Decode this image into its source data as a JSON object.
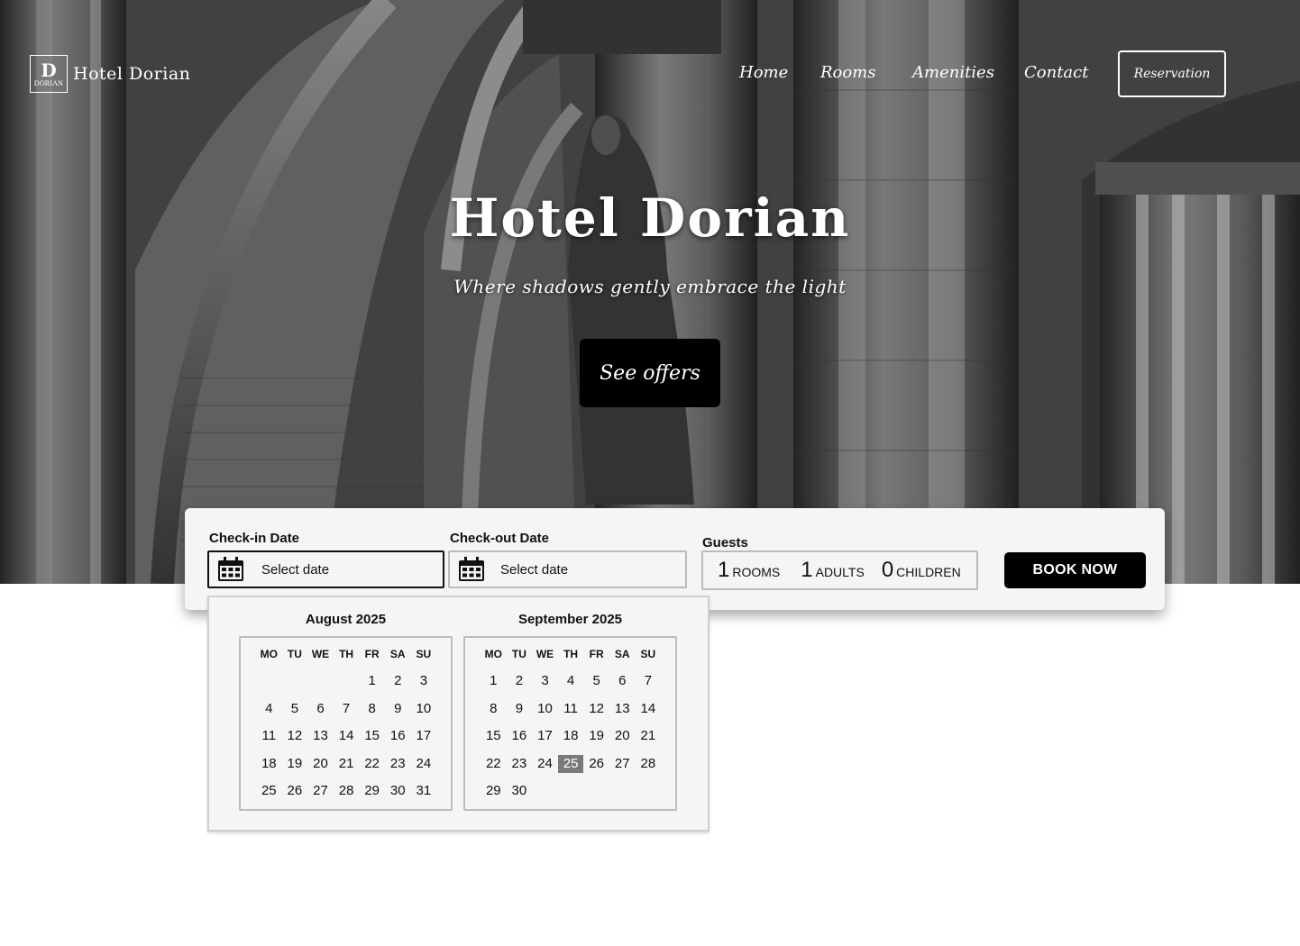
{
  "brand": {
    "logo_letter": "D",
    "logo_sub": "DORIAN",
    "name": "Hotel Dorian"
  },
  "nav": {
    "items": [
      "Home",
      "Rooms",
      "Amenities",
      "Contact"
    ],
    "reservation_label": "Reservation"
  },
  "hero": {
    "title": "Hotel Dorian",
    "subtitle": "Where shadows gently embrace the light",
    "cta_label": "See offers"
  },
  "booking": {
    "checkin_label": "Check-in Date",
    "checkin_value": "Select date",
    "checkout_label": "Check-out Date",
    "checkout_value": "Select date",
    "guests_label": "Guests",
    "rooms_count": "1",
    "rooms_label": "ROOMS",
    "adults_count": "1",
    "adults_label": "ADULTS",
    "children_count": "0",
    "children_label": "CHILDREN",
    "book_label": "BOOK NOW"
  },
  "calendar": {
    "weekdays": [
      "MO",
      "TU",
      "WE",
      "TH",
      "FR",
      "SA",
      "SU"
    ],
    "months": [
      {
        "title": "August 2025",
        "weeks": [
          [
            "",
            "",
            "",
            "",
            "1",
            "2",
            "3"
          ],
          [
            "4",
            "5",
            "6",
            "7",
            "8",
            "9",
            "10"
          ],
          [
            "11",
            "12",
            "13",
            "14",
            "15",
            "16",
            "17"
          ],
          [
            "18",
            "19",
            "20",
            "21",
            "22",
            "23",
            "24"
          ],
          [
            "25",
            "26",
            "27",
            "28",
            "29",
            "30",
            "31"
          ]
        ],
        "selected": ""
      },
      {
        "title": "September 2025",
        "weeks": [
          [
            "1",
            "2",
            "3",
            "4",
            "5",
            "6",
            "7"
          ],
          [
            "8",
            "9",
            "10",
            "11",
            "12",
            "13",
            "14"
          ],
          [
            "15",
            "16",
            "17",
            "18",
            "19",
            "20",
            "21"
          ],
          [
            "22",
            "23",
            "24",
            "25",
            "26",
            "27",
            "28"
          ],
          [
            "29",
            "30",
            "",
            "",
            "",
            "",
            ""
          ]
        ],
        "selected": "25"
      }
    ]
  },
  "colors": {
    "accent": "#000000",
    "selected_day": "#7a7a7a",
    "panel": "#f5f5f5"
  }
}
